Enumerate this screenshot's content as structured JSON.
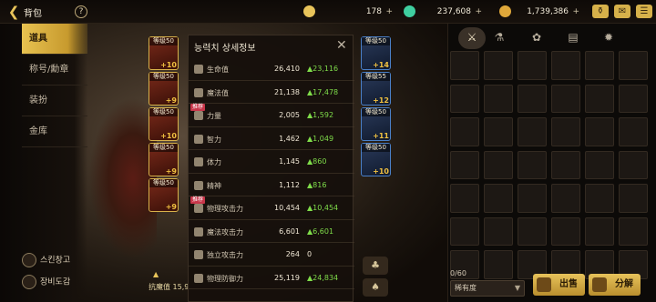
{
  "header": {
    "title": "背包",
    "back_icon": "back-arrow-icon",
    "help_icon": "help-icon"
  },
  "currencies": [
    {
      "icon": "gold-c-coin-icon",
      "value": "178",
      "plus": "+",
      "color": "#e8c45a"
    },
    {
      "icon": "green-gem-icon",
      "value": "237,608",
      "plus": "+",
      "color": "#3fcfa0"
    },
    {
      "icon": "gold-coin-icon",
      "value": "1,739,386",
      "plus": "+",
      "color": "#e0a83a"
    }
  ],
  "top_icons": [
    "treasure-pot-icon",
    "mail-icon",
    "settings-grid-icon"
  ],
  "sidebar": {
    "tabs": [
      {
        "label": "道具",
        "active": true
      },
      {
        "label": "称号/勳章",
        "active": false
      },
      {
        "label": "装扮",
        "active": false
      },
      {
        "label": "金库",
        "active": false
      }
    ],
    "bottom_links": [
      {
        "label": "스킨창고",
        "icon": "skin-storage-icon"
      },
      {
        "label": "장비도감",
        "icon": "equipment-book-icon"
      }
    ]
  },
  "equip_slots_left": [
    {
      "level": "等级50",
      "plus": "+10"
    },
    {
      "level": "等级50",
      "plus": "+9"
    },
    {
      "level": "等级50",
      "plus": "+10"
    },
    {
      "level": "等级50",
      "plus": "+9"
    },
    {
      "level": "等级50",
      "plus": "+9"
    }
  ],
  "equip_slots_right": [
    {
      "level": "等级50",
      "plus": "+14"
    },
    {
      "level": "等级55",
      "plus": "+12"
    },
    {
      "level": "等级50",
      "plus": "+11"
    },
    {
      "level": "等级50",
      "plus": "+10"
    }
  ],
  "stats_panel": {
    "title": "능력치 상세정보",
    "close_icon": "close-icon",
    "recommend_tag": "推荐",
    "rows": [
      {
        "icon": "heart-icon",
        "name": "生命值",
        "value": "26,410",
        "inc": "▲23,116",
        "rec": false
      },
      {
        "icon": "heart-outline-icon",
        "name": "魔法值",
        "value": "21,138",
        "inc": "▲17,478",
        "rec": false
      },
      {
        "icon": "strength-icon",
        "name": "力量",
        "value": "2,005",
        "inc": "▲1,592",
        "rec": true
      },
      {
        "icon": "intelligence-icon",
        "name": "智力",
        "value": "1,462",
        "inc": "▲1,049",
        "rec": false
      },
      {
        "icon": "stamina-icon",
        "name": "体力",
        "value": "1,145",
        "inc": "▲860",
        "rec": false
      },
      {
        "icon": "spirit-icon",
        "name": "精神",
        "value": "1,112",
        "inc": "▲816",
        "rec": false
      },
      {
        "icon": "physical-attack-icon",
        "name": "物理攻击力",
        "value": "10,454",
        "inc": "▲10,454",
        "rec": true
      },
      {
        "icon": "magic-attack-icon",
        "name": "魔法攻击力",
        "value": "6,601",
        "inc": "▲6,601",
        "rec": false
      },
      {
        "icon": "independent-attack-icon",
        "name": "独立攻击力",
        "value": "264",
        "inc": "0",
        "rec": false
      },
      {
        "icon": "physical-defense-icon",
        "name": "物理防御力",
        "value": "25,119",
        "inc": "▲24,834",
        "rec": false
      }
    ]
  },
  "resist_label": "抗魔值 15,9",
  "inventory": {
    "tabs": [
      "equipment-icon",
      "potion-icon",
      "material-icon",
      "cards-icon",
      "gear-icon"
    ],
    "count": "0/60",
    "sort_label": "稀有度",
    "buttons": [
      {
        "label": "出售",
        "icon": "sell-icon"
      },
      {
        "label": "分解",
        "icon": "disassemble-icon"
      }
    ]
  }
}
